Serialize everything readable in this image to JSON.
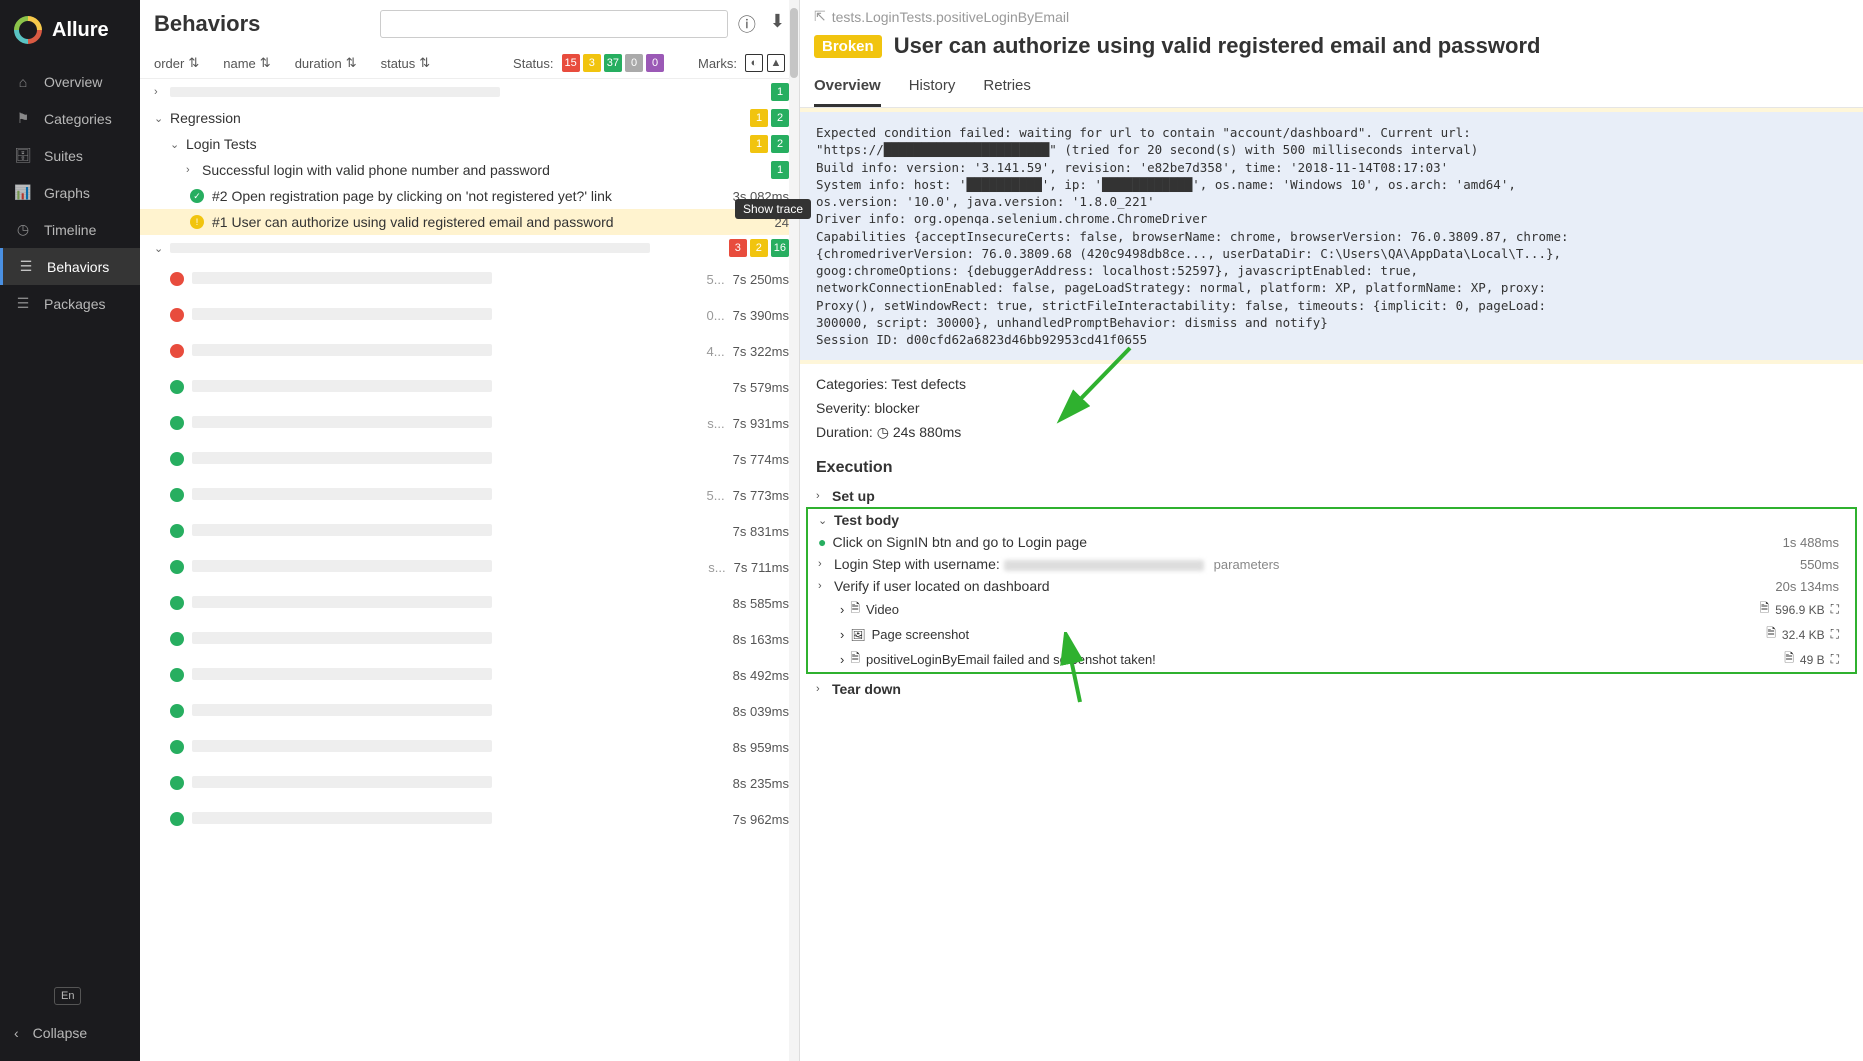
{
  "brand": "Allure",
  "nav": {
    "overview": "Overview",
    "categories": "Categories",
    "suites": "Suites",
    "graphs": "Graphs",
    "timeline": "Timeline",
    "behaviors": "Behaviors",
    "packages": "Packages",
    "lang": "En",
    "collapse": "Collapse"
  },
  "mid": {
    "title": "Behaviors",
    "sort": {
      "order": "order",
      "name": "name",
      "duration": "duration",
      "status": "status"
    },
    "status_label": "Status:",
    "marks_label": "Marks:",
    "status_counts": {
      "failed": "15",
      "broken": "3",
      "passed": "37",
      "skipped": "0",
      "unknown": "0"
    },
    "tooltip": "Show trace",
    "tree": {
      "regression": "Regression",
      "login_tests": "Login Tests",
      "success_phone": "Successful login with valid phone number and password",
      "t2": "#2   Open registration page by clicking on 'not registered yet?' link",
      "t2_dur": "3s 082ms",
      "t1": "#1   User can authorize using valid registered email and password",
      "t1_dur": "24",
      "reg_badges": {
        "a": "1",
        "b": "2"
      },
      "login_badges": {
        "a": "1",
        "b": "2"
      },
      "phone_badge": "1",
      "blurred_group_badges": {
        "r": "3",
        "y": "2",
        "g": "16"
      },
      "rows": [
        {
          "st": "fail",
          "dur": "7s 250ms",
          "extra": "5..."
        },
        {
          "st": "fail",
          "dur": "7s 390ms",
          "extra": "0..."
        },
        {
          "st": "fail",
          "dur": "7s 322ms",
          "extra": "4..."
        },
        {
          "st": "pass",
          "dur": "7s 579ms",
          "extra": ""
        },
        {
          "st": "pass",
          "dur": "7s 931ms",
          "extra": "s..."
        },
        {
          "st": "pass",
          "dur": "7s 774ms",
          "extra": ""
        },
        {
          "st": "pass",
          "dur": "7s 773ms",
          "extra": "5..."
        },
        {
          "st": "pass",
          "dur": "7s 831ms",
          "extra": ""
        },
        {
          "st": "pass",
          "dur": "7s 711ms",
          "extra": "s..."
        },
        {
          "st": "pass",
          "dur": "8s 585ms",
          "extra": ""
        },
        {
          "st": "pass",
          "dur": "8s 163ms",
          "extra": ""
        },
        {
          "st": "pass",
          "dur": "8s 492ms",
          "extra": ""
        },
        {
          "st": "pass",
          "dur": "8s 039ms",
          "extra": ""
        },
        {
          "st": "pass",
          "dur": "8s 959ms",
          "extra": ""
        },
        {
          "st": "pass",
          "dur": "8s 235ms",
          "extra": ""
        },
        {
          "st": "pass",
          "dur": "7s 962ms",
          "extra": ""
        }
      ]
    }
  },
  "right": {
    "crumb": "tests.LoginTests.positiveLoginByEmail",
    "broken": "Broken",
    "title": "User can authorize using valid registered email and password",
    "tabs": {
      "overview": "Overview",
      "history": "History",
      "retries": "Retries"
    },
    "error": "Expected condition failed: waiting for url to contain \"account/dashboard\". Current url:\n\"https://██████████████████████\" (tried for 20 second(s) with 500 milliseconds interval)\nBuild info: version: '3.141.59', revision: 'e82be7d358', time: '2018-11-14T08:17:03'\nSystem info: host: '██████████', ip: '████████████', os.name: 'Windows 10', os.arch: 'amd64',\nos.version: '10.0', java.version: '1.8.0_221'\nDriver info: org.openqa.selenium.chrome.ChromeDriver\nCapabilities {acceptInsecureCerts: false, browserName: chrome, browserVersion: 76.0.3809.87, chrome:\n{chromedriverVersion: 76.0.3809.68 (420c9498db8ce..., userDataDir: C:\\Users\\QA\\AppData\\Local\\T...},\ngoog:chromeOptions: {debuggerAddress: localhost:52597}, javascriptEnabled: true,\nnetworkConnectionEnabled: false, pageLoadStrategy: normal, platform: XP, platformName: XP, proxy:\nProxy(), setWindowRect: true, strictFileInteractability: false, timeouts: {implicit: 0, pageLoad:\n300000, script: 30000}, unhandledPromptBehavior: dismiss and notify}\nSession ID: d00cfd62a6823d46bb92953cd41f0655",
    "meta": {
      "categories_l": "Categories:",
      "categories_v": "Test defects",
      "severity_l": "Severity:",
      "severity_v": "blocker",
      "duration_l": "Duration:",
      "duration_v": "24s 880ms"
    },
    "exec": "Execution",
    "setup": "Set up",
    "testbody": "Test body",
    "steps": {
      "s1": "Click on SignIN btn and go to Login page",
      "s1d": "1s 488ms",
      "s2": "Login Step with username:",
      "s2_param": "parameters",
      "s2d": "550ms",
      "s3": "Verify if user located on dashboard",
      "s3d": "20s 134ms",
      "a1": "Video",
      "a1s": "596.9 KB",
      "a2": "Page screenshot",
      "a2s": "32.4 KB",
      "a3": "positiveLoginByEmail failed and screenshot taken!",
      "a3s": "49 B"
    },
    "teardown": "Tear down"
  }
}
